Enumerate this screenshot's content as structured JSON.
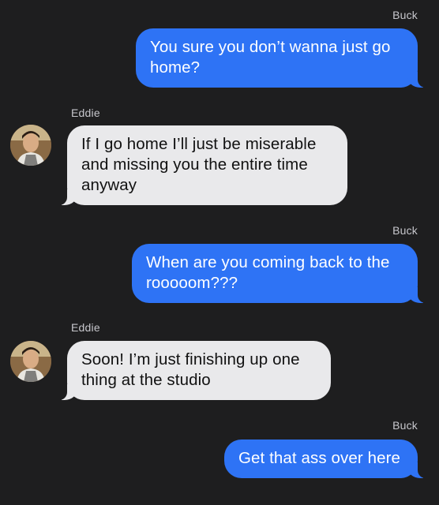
{
  "messages": [
    {
      "sender": "Buck",
      "direction": "out",
      "text": "You sure you don’t wanna just go home?"
    },
    {
      "sender": "Eddie",
      "direction": "in",
      "text": "If I go home I’ll just be miserable and missing you the entire time anyway"
    },
    {
      "sender": "Buck",
      "direction": "out",
      "text": "When are you coming back to the rooooom???"
    },
    {
      "sender": "Eddie",
      "direction": "in",
      "text": "Soon! I’m just finishing up one thing at the studio"
    },
    {
      "sender": "Buck",
      "direction": "out",
      "text": "Get that ass over here"
    }
  ],
  "colors": {
    "background": "#1e1e1f",
    "outgoing_bubble": "#2e73f5",
    "incoming_bubble": "#e9e9eb",
    "sender_name": "#c7c7cc"
  },
  "icons": {
    "avatar": "profile-photo"
  }
}
